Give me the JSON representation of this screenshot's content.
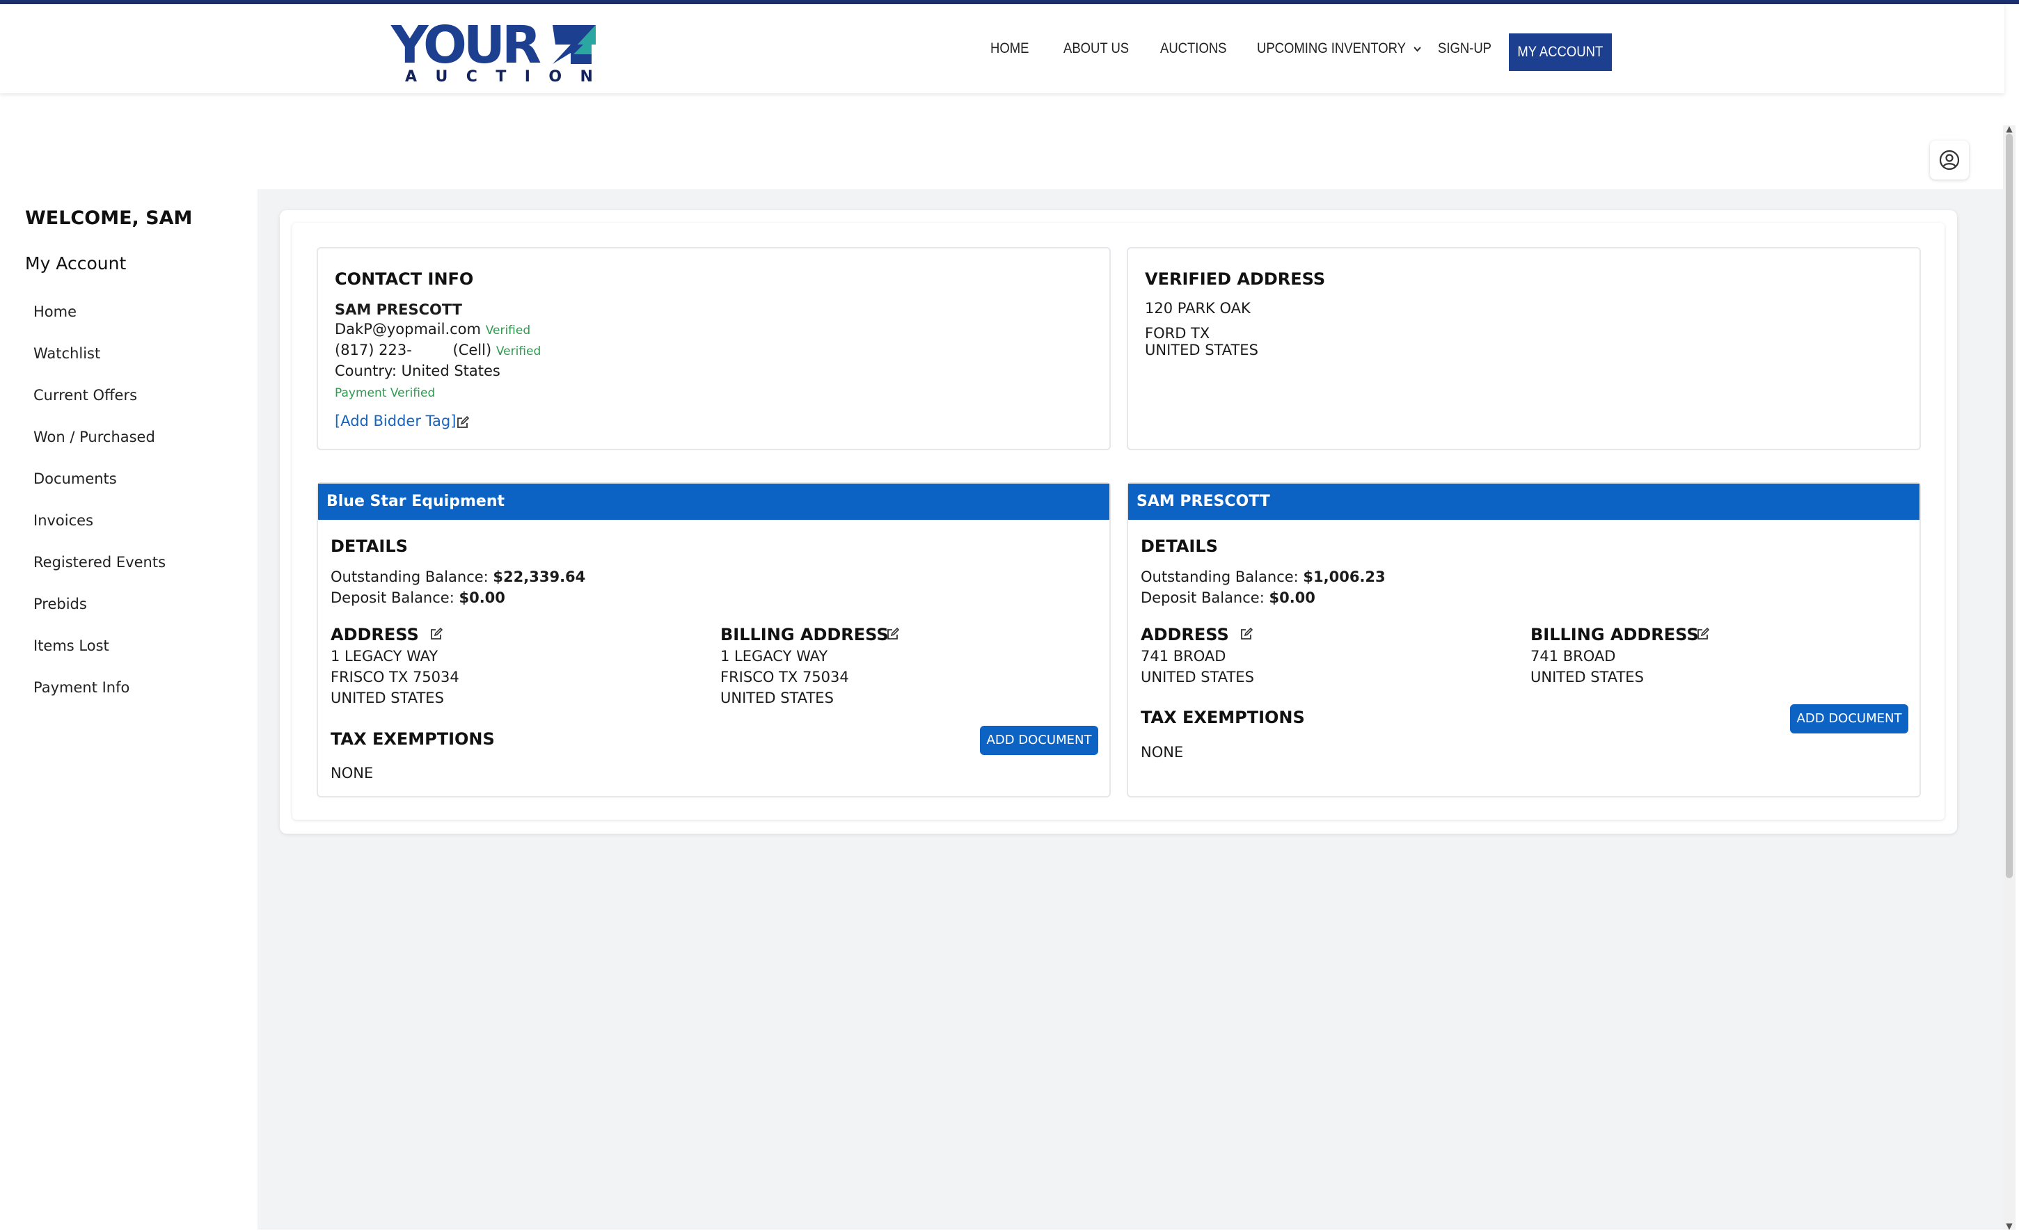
{
  "brand": {
    "logo_main": "YOUR",
    "logo_sub": [
      "A",
      "U",
      "C",
      "T",
      "I",
      "O",
      "N"
    ],
    "primary": "#1d3f8f",
    "accent": "#0d63c3",
    "verified": "#2e9b4f"
  },
  "nav": {
    "items": [
      "HOME",
      "ABOUT US",
      "AUCTIONS",
      "UPCOMING INVENTORY",
      "SIGN-UP"
    ],
    "my_account": "MY ACCOUNT"
  },
  "sidebar": {
    "welcome": "WELCOME, SAM",
    "heading": "My Account",
    "items": [
      "Home",
      "Watchlist",
      "Current Offers",
      "Won / Purchased",
      "Documents",
      "Invoices",
      "Registered Events",
      "Prebids",
      "Items Lost",
      "Payment Info"
    ]
  },
  "contact": {
    "title": "CONTACT INFO",
    "name": "SAM PRESCOTT",
    "email": "DakP@yopmail.com",
    "email_status": "Verified",
    "phone": "(817) 223-",
    "phone_type": "(Cell)",
    "phone_status": "Verified",
    "country": "Country: United States",
    "payment_status": "Payment Verified",
    "bidder_tag": "[Add Bidder Tag]"
  },
  "verified_address": {
    "title": "VERIFIED ADDRESS",
    "line1": "120 PARK OAK",
    "line2": "FORD TX",
    "line3": "UNITED STATES"
  },
  "accounts": [
    {
      "header": "Blue Star Equipment",
      "details_title": "DETAILS",
      "outstanding_label": "Outstanding Balance:",
      "outstanding_value": "$22,339.64",
      "deposit_label": "Deposit Balance:",
      "deposit_value": "$0.00",
      "address_title": "ADDRESS",
      "address": [
        "1 LEGACY WAY",
        "FRISCO TX 75034",
        "UNITED STATES"
      ],
      "billing_title": "BILLING ADDRESS",
      "billing": [
        "1 LEGACY WAY",
        "FRISCO TX 75034",
        "UNITED STATES"
      ],
      "tax_title": "TAX EXEMPTIONS",
      "tax_value": "NONE",
      "add_document": "ADD DOCUMENT"
    },
    {
      "header": "SAM PRESCOTT",
      "details_title": "DETAILS",
      "outstanding_label": "Outstanding Balance:",
      "outstanding_value": "$1,006.23",
      "deposit_label": "Deposit Balance:",
      "deposit_value": "$0.00",
      "address_title": "ADDRESS",
      "address": [
        "741 BROAD",
        "UNITED STATES"
      ],
      "billing_title": "BILLING ADDRESS",
      "billing": [
        "741 BROAD",
        "UNITED STATES"
      ],
      "tax_title": "TAX EXEMPTIONS",
      "tax_value": "NONE",
      "add_document": "ADD DOCUMENT"
    }
  ]
}
